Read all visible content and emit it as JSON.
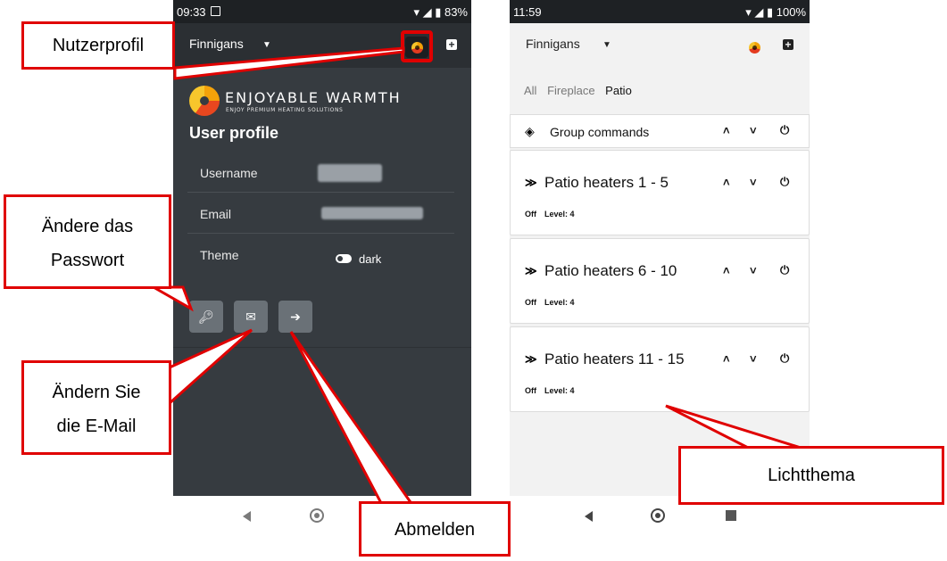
{
  "left_phone": {
    "status": {
      "time": "09:33",
      "battery": "83%"
    },
    "topbar": {
      "location": "Finnigans"
    },
    "logo": {
      "name": "ENJOYABLE WARMTH",
      "tagline": "ENJOY PREMIUM HEATING SOLUTIONS"
    },
    "profile": {
      "title": "User profile",
      "rows": [
        {
          "label": "Username"
        },
        {
          "label": "Email"
        },
        {
          "label": "Theme",
          "value": "dark"
        }
      ]
    },
    "actions": [
      {
        "icon": "key-icon"
      },
      {
        "icon": "envelope-icon"
      },
      {
        "icon": "sign-out-icon"
      }
    ]
  },
  "right_phone": {
    "status": {
      "time": "11:59",
      "battery": "100%"
    },
    "topbar": {
      "location": "Finnigans"
    },
    "tabs": [
      "All",
      "Fireplace",
      "Patio"
    ],
    "active_tab": "Patio",
    "group": {
      "label": "Group commands"
    },
    "cards": [
      {
        "title": "Patio heaters 1 - 5",
        "state": "Off",
        "level": "Level: 4"
      },
      {
        "title": "Patio heaters 6 - 10",
        "state": "Off",
        "level": "Level: 4"
      },
      {
        "title": "Patio heaters 11 - 15",
        "state": "Off",
        "level": "Level: 4"
      }
    ]
  },
  "callouts": {
    "user_profile": "Nutzerprofil",
    "change_password_l1": "Ändere das",
    "change_password_l2": "Passwort",
    "change_email_l1": "Ändern Sie",
    "change_email_l2": "die E-Mail",
    "logout": "Abmelden",
    "light_theme": "Lichtthema"
  },
  "colors": {
    "annotation": "#e00000",
    "dark_bg": "#363b40",
    "light_bg": "#f2f2f2",
    "status_bar": "#1e2124"
  }
}
